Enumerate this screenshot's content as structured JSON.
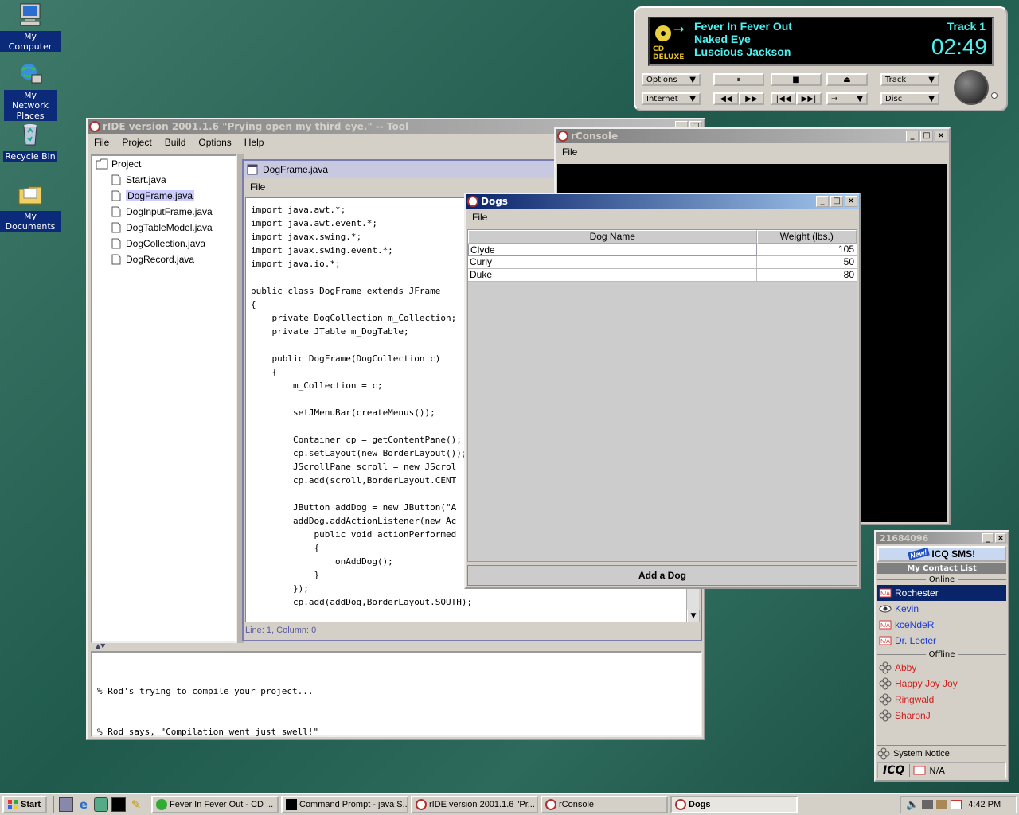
{
  "desktop": {
    "icons": [
      {
        "label": "My Computer"
      },
      {
        "label": "My Network Places"
      },
      {
        "label": "Recycle Bin"
      },
      {
        "label": "My Documents"
      }
    ]
  },
  "cd_player": {
    "song": "Fever In Fever Out",
    "album": "Naked Eye",
    "artist": "Luscious Jackson",
    "track": "Track 1",
    "time": "02:49",
    "logo": "CD DELUXE",
    "buttons": {
      "options": "Options",
      "internet": "Internet",
      "track": "Track",
      "disc": "Disc"
    },
    "icons": {
      "pause": "⏸",
      "stop": "■",
      "eject": "⏏",
      "rew": "◀◀",
      "ff": "▶▶",
      "prev": "|◀◀",
      "next": "▶▶|",
      "arrow": "→"
    }
  },
  "ride": {
    "title": "rIDE version 2001.1.6 \"Prying open my third eye.\" -- Tool",
    "menu": [
      "File",
      "Project",
      "Build",
      "Options",
      "Help"
    ],
    "tree_root": "Project",
    "files": [
      "Start.java",
      "DogFrame.java",
      "DogInputFrame.java",
      "DogTableModel.java",
      "DogCollection.java",
      "DogRecord.java"
    ],
    "editor_title": "DogFrame.java",
    "editor_menu": "File",
    "code": [
      "import java.awt.*;",
      "import java.awt.event.*;",
      "import javax.swing.*;",
      "import javax.swing.event.*;",
      "import java.io.*;",
      "",
      "public class DogFrame extends JFrame",
      "{",
      "    private DogCollection m_Collection;",
      "    private JTable m_DogTable;",
      "",
      "    public DogFrame(DogCollection c)",
      "    {",
      "        m_Collection = c;",
      "",
      "        setJMenuBar(createMenus());",
      "",
      "        Container cp = getContentPane();",
      "        cp.setLayout(new BorderLayout());",
      "        JScrollPane scroll = new JScrol",
      "        cp.add(scroll,BorderLayout.CENT",
      "",
      "        JButton addDog = new JButton(\"A",
      "        addDog.addActionListener(new Ac",
      "            public void actionPerformed",
      "            {",
      "                onAddDog();",
      "            }",
      "        });",
      "        cp.add(addDog,BorderLayout.SOUTH);"
    ],
    "status": "Line: 1, Column: 0",
    "output": [
      "% Rod's trying to compile your project...",
      "% Rod says, \"Compilation went just swell!\""
    ]
  },
  "console": {
    "title": "rConsole",
    "menu": "File"
  },
  "dogs": {
    "title": "Dogs",
    "menu": "File",
    "columns": [
      "Dog Name",
      "Weight (lbs.)"
    ],
    "rows": [
      {
        "name": "Clyde",
        "weight": "105"
      },
      {
        "name": "Curly",
        "weight": "50"
      },
      {
        "name": "Duke",
        "weight": "80"
      }
    ],
    "button": "Add a Dog"
  },
  "icq": {
    "uin": "21684096",
    "sms": "ICQ SMS!",
    "sms_badge": "New!",
    "contact_list": "My Contact List",
    "online_label": "Online",
    "offline_label": "Offline",
    "online": [
      "Rochester",
      "Kevin",
      "kceNdeR",
      "Dr. Lecter"
    ],
    "offline": [
      "Abby",
      "Happy Joy Joy",
      "Ringwald",
      "SharonJ"
    ],
    "system_notice": "System Notice",
    "logo": "ICQ",
    "status": "N/A"
  },
  "taskbar": {
    "start": "Start",
    "tasks": [
      "Fever In Fever Out - CD ...",
      "Command Prompt - java S...",
      "rIDE version 2001.1.6 \"Pr...",
      "rConsole",
      "Dogs"
    ],
    "clock": "4:42 PM"
  }
}
